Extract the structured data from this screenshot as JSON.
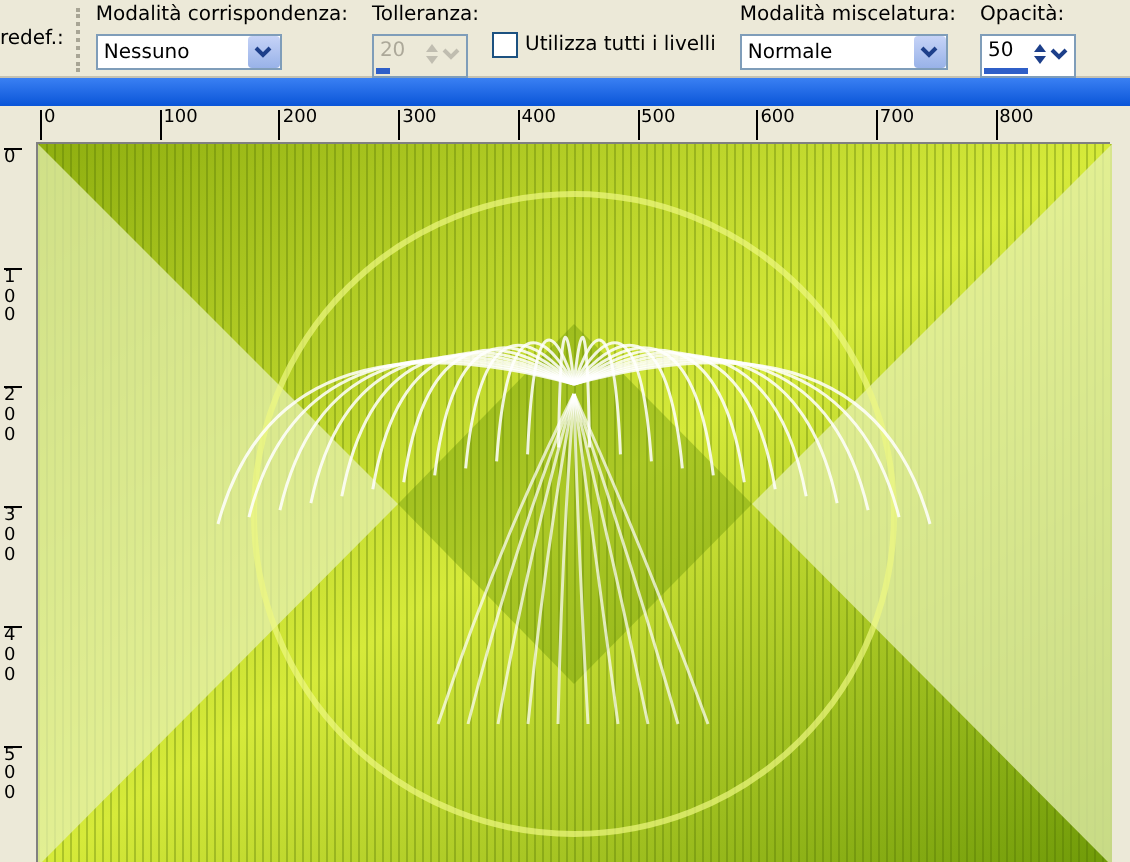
{
  "toolbar": {
    "preset_label": "redef.:",
    "match_mode": {
      "label": "Modalità corrispondenza:",
      "value": "Nessuno"
    },
    "tolerance": {
      "label": "Tolleranza:",
      "value": "20",
      "disabled": true,
      "level": 0.15
    },
    "all_layers": {
      "label": "Utilizza tutti i livelli",
      "checked": false
    },
    "blend_mode": {
      "label": "Modalità miscelatura:",
      "value": "Normale"
    },
    "opacity": {
      "label": "Opacità:",
      "value": "50",
      "disabled": false,
      "level": 0.5
    }
  },
  "horizontal_ruler": {
    "labels": [
      "0",
      "100",
      "200",
      "300",
      "400",
      "500",
      "600",
      "700",
      "800"
    ]
  },
  "vertical_ruler": {
    "labels": [
      "0",
      "100",
      "200",
      "300",
      "400",
      "500"
    ]
  }
}
